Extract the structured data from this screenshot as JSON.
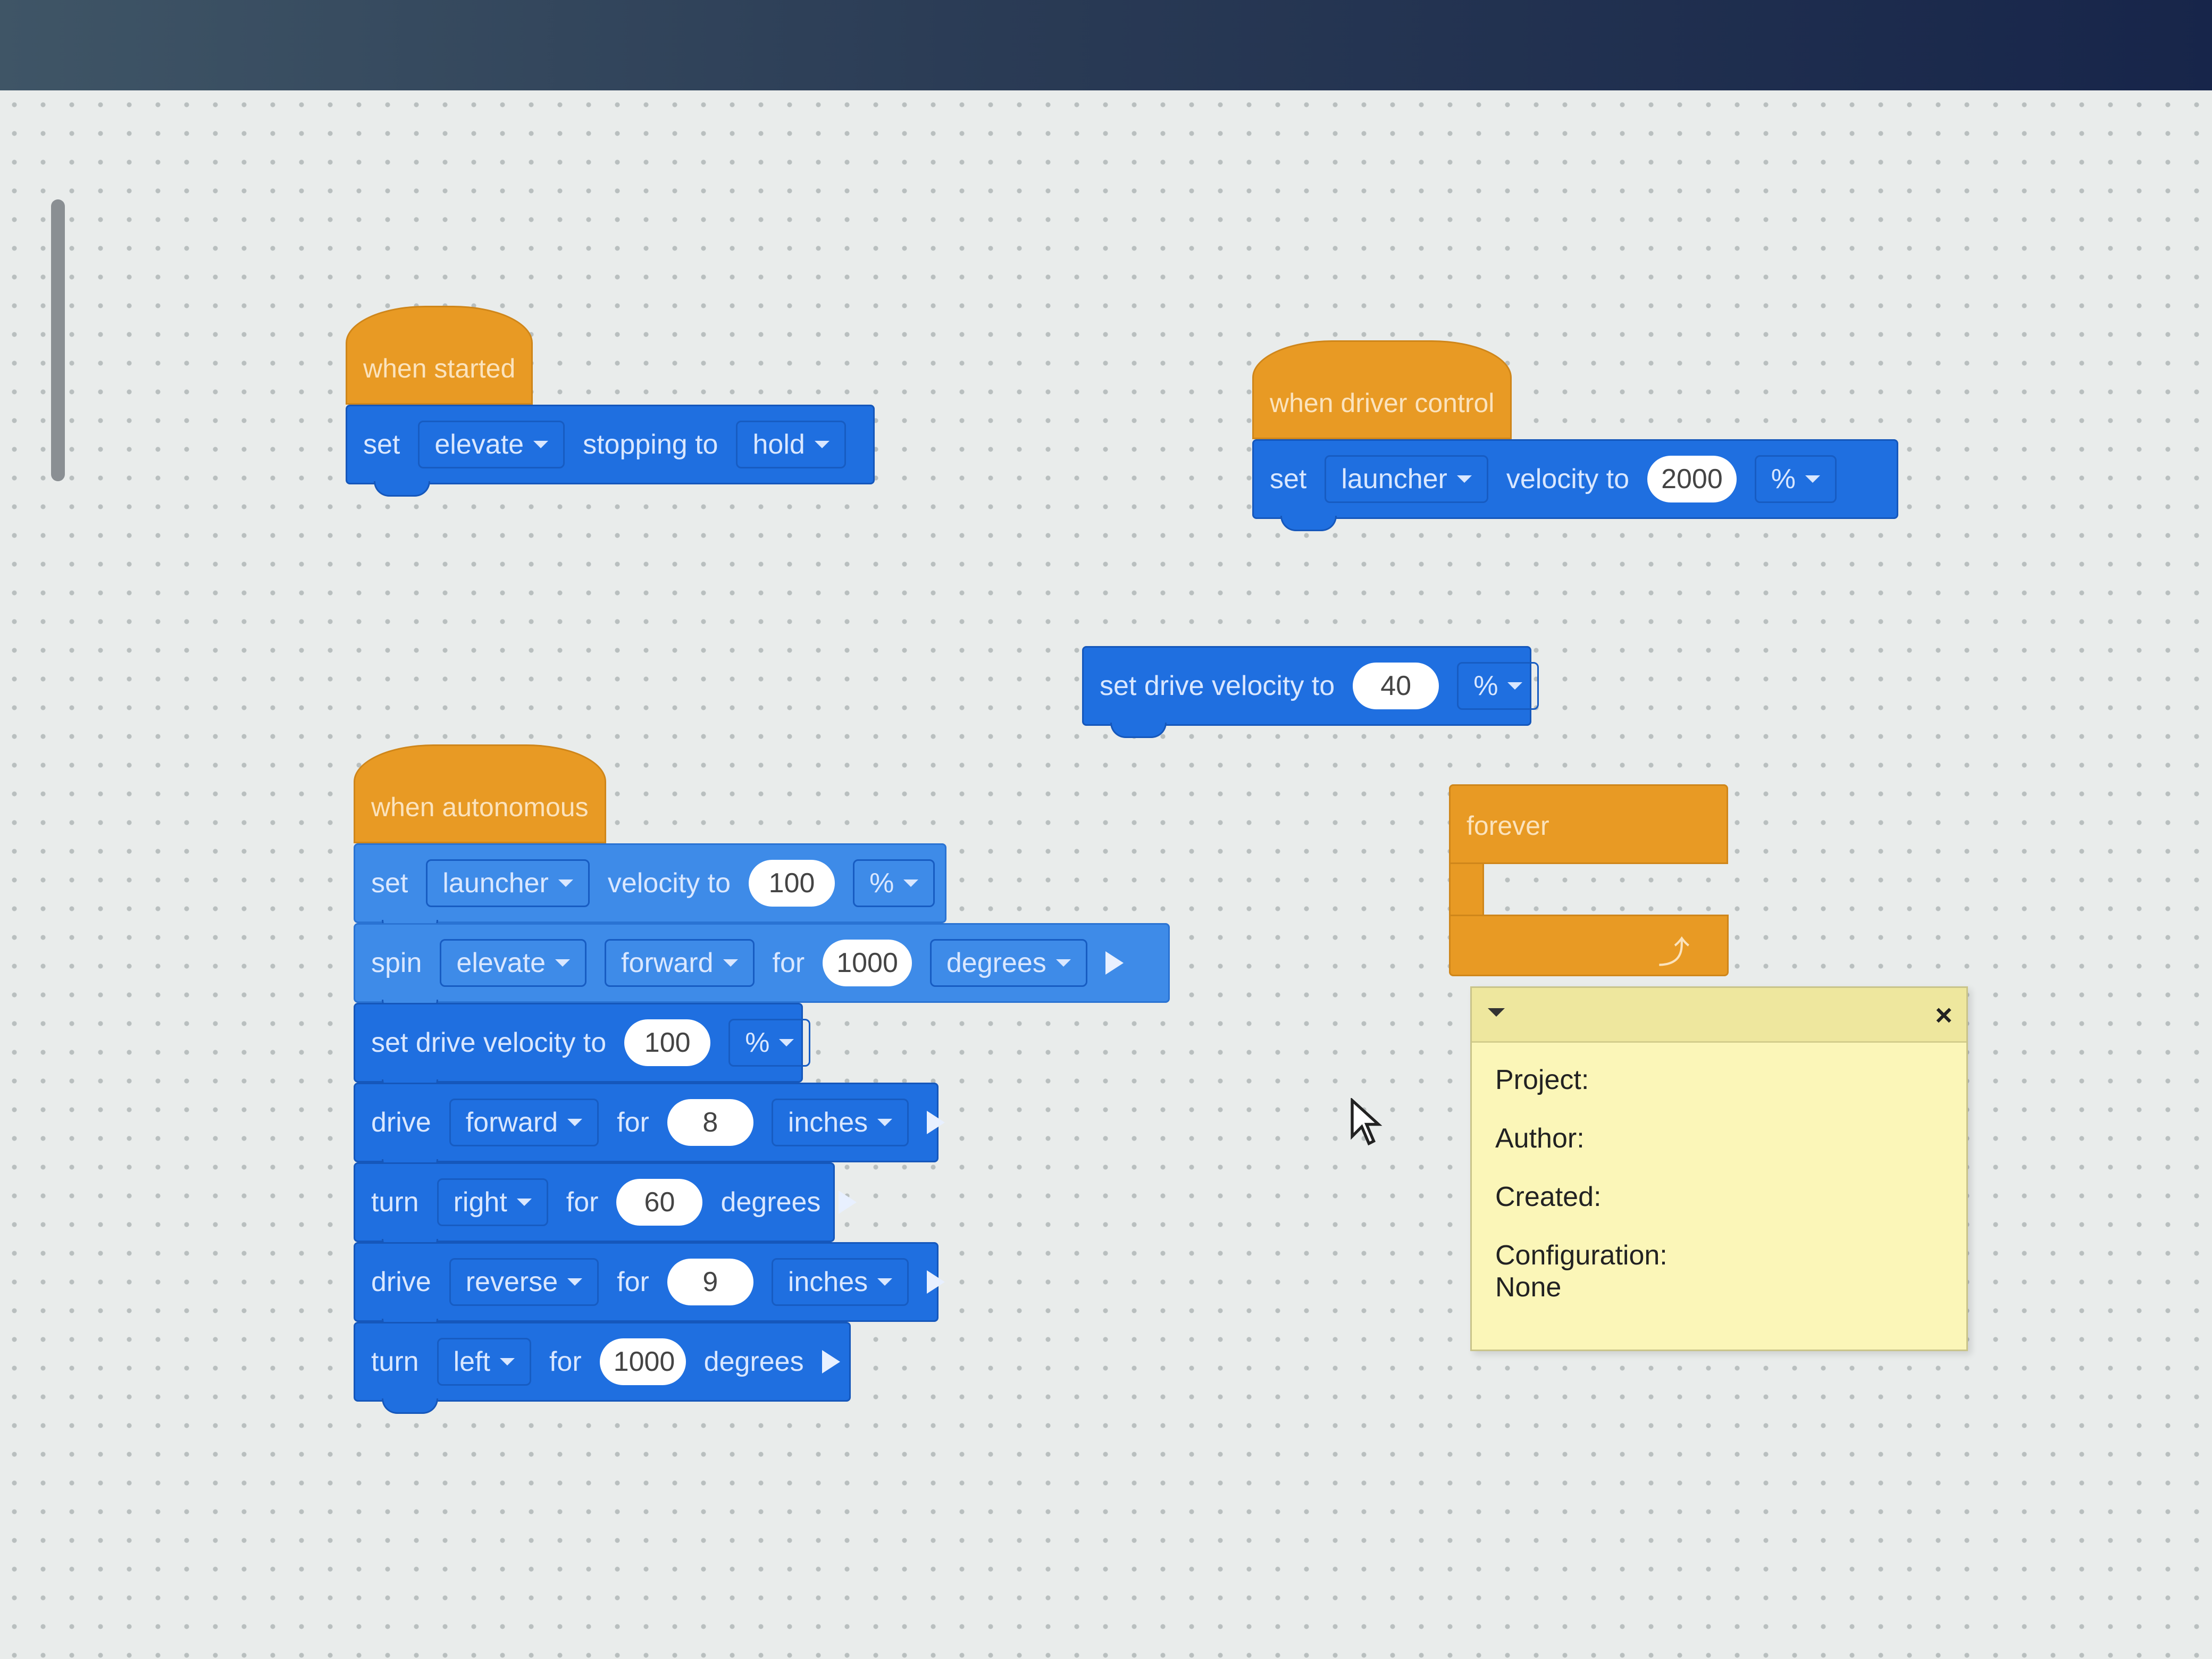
{
  "workspace": {
    "stacks": {
      "when_started": {
        "hat": "when started",
        "set_stopping": {
          "label_set": "set",
          "motor": "elevate",
          "label_stopping": "stopping to",
          "mode": "hold"
        }
      },
      "when_driver_control": {
        "hat": "when driver control",
        "set_velocity": {
          "label_set": "set",
          "motor": "launcher",
          "label_velocity": "velocity to",
          "value": "2000",
          "unit": "%"
        }
      },
      "loose_drive_velocity": {
        "label": "set drive velocity to",
        "value": "40",
        "unit": "%"
      },
      "when_autonomous": {
        "hat": "when autonomous",
        "blocks": {
          "b0": {
            "label_set": "set",
            "motor": "launcher",
            "label_velocity": "velocity to",
            "value": "100",
            "unit": "%"
          },
          "b1": {
            "label_spin": "spin",
            "motor": "elevate",
            "direction": "forward",
            "label_for": "for",
            "value": "1000",
            "unit": "degrees"
          },
          "b2": {
            "label": "set drive velocity to",
            "value": "100",
            "unit": "%"
          },
          "b3": {
            "label_drive": "drive",
            "direction": "forward",
            "label_for": "for",
            "value": "8",
            "unit": "inches"
          },
          "b4": {
            "label_turn": "turn",
            "direction": "right",
            "label_for": "for",
            "value": "60",
            "unit": "degrees"
          },
          "b5": {
            "label_drive": "drive",
            "direction": "reverse",
            "label_for": "for",
            "value": "9",
            "unit": "inches"
          },
          "b6": {
            "label_turn": "turn",
            "direction": "left",
            "label_for": "for",
            "value": "1000",
            "unit": "degrees"
          }
        }
      },
      "forever": {
        "label": "forever",
        "icon": "loop-arrow-icon"
      }
    },
    "comment": {
      "close": "×",
      "project": "Project:",
      "author": "Author:",
      "created": "Created:",
      "configuration": "Configuration:",
      "configuration_value": "None"
    }
  }
}
